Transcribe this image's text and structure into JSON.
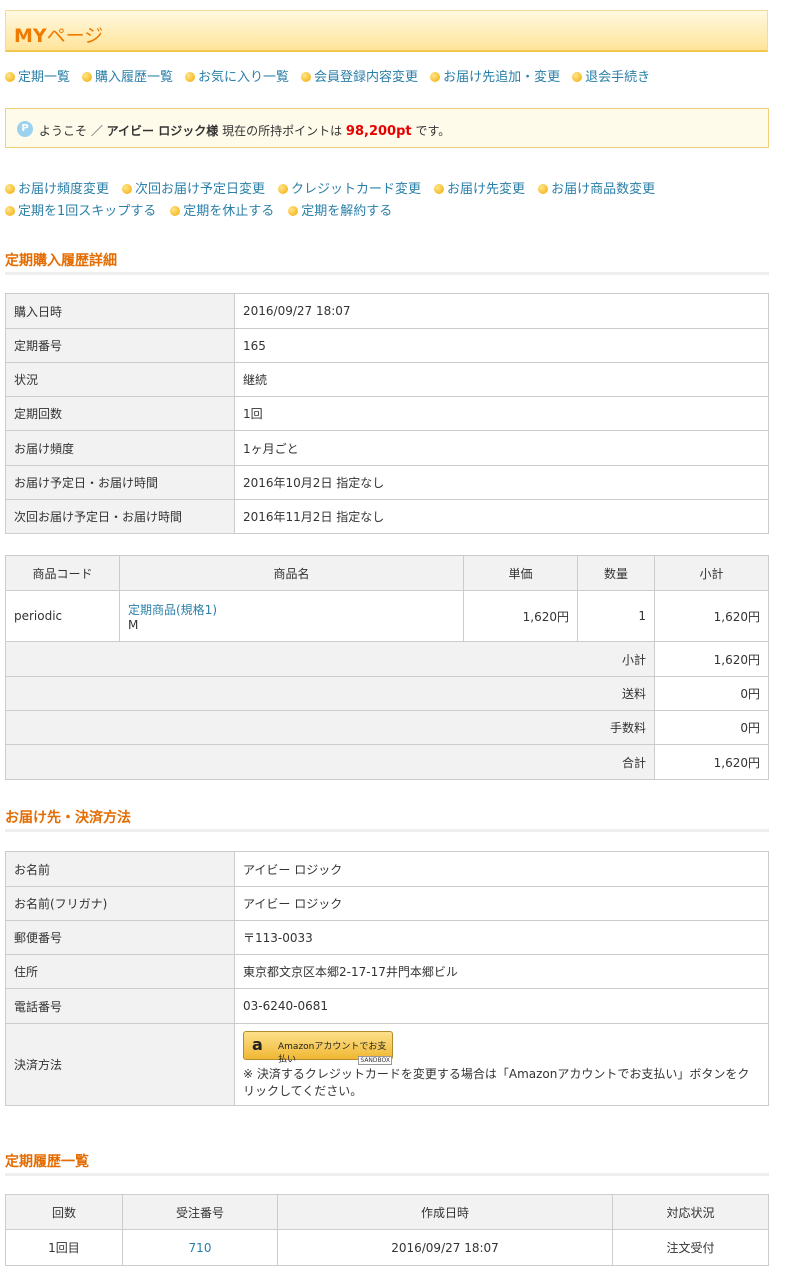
{
  "header": {
    "title_bold": "MY",
    "title_rest": "ページ"
  },
  "nav": [
    "定期一覧",
    "購入履歴一覧",
    "お気に入り一覧",
    "会員登録内容変更",
    "お届け先追加・変更",
    "退会手続き"
  ],
  "welcome": {
    "icon": "P",
    "prefix": "ようこそ ／",
    "user": "アイビー ロジック様",
    "points_label": "現在の所持ポイントは",
    "points": "98,200pt",
    "suffix": "です。"
  },
  "actions_row1": [
    "お届け頻度変更",
    "次回お届け予定日変更",
    "クレジットカード変更",
    "お届け先変更",
    "お届け商品数変更"
  ],
  "actions_row2": [
    "定期を1回スキップする",
    "定期を休止する",
    "定期を解約する"
  ],
  "detail": {
    "title": "定期購入履歴詳細",
    "rows": [
      {
        "label": "購入日時",
        "value": "2016/09/27 18:07"
      },
      {
        "label": "定期番号",
        "value": "165"
      },
      {
        "label": "状況",
        "value": "継続"
      },
      {
        "label": "定期回数",
        "value": "1回"
      },
      {
        "label": "お届け頻度",
        "value": "1ヶ月ごと"
      },
      {
        "label": "お届け予定日・お届け時間",
        "value": "2016年10月2日 指定なし"
      },
      {
        "label": "次回お届け予定日・お届け時間",
        "value": "2016年11月2日 指定なし"
      }
    ]
  },
  "items": {
    "headers": [
      "商品コード",
      "商品名",
      "単価",
      "数量",
      "小計"
    ],
    "rows": [
      {
        "code": "periodic",
        "name": "定期商品(規格1)",
        "variant": "M",
        "price": "1,620円",
        "qty": "1",
        "subtotal": "1,620円"
      }
    ],
    "summary": [
      {
        "label": "小計",
        "value": "1,620円"
      },
      {
        "label": "送料",
        "value": "0円"
      },
      {
        "label": "手数料",
        "value": "0円"
      },
      {
        "label": "合計",
        "value": "1,620円"
      }
    ]
  },
  "delivery": {
    "title": "お届け先・決済方法",
    "rows": [
      {
        "label": "お名前",
        "value": "アイビー ロジック"
      },
      {
        "label": "お名前(フリガナ)",
        "value": "アイビー ロジック"
      },
      {
        "label": "郵便番号",
        "value": "〒113-0033"
      },
      {
        "label": "住所",
        "value": "東京都文京区本郷2-17-17井門本郷ビル"
      },
      {
        "label": "電話番号",
        "value": "03-6240-0681"
      }
    ],
    "payment_label": "決済方法",
    "amazon_button": "Amazonアカウントでお支払い",
    "amazon_sandbox": "SANDBOX",
    "payment_note": "※ 決済するクレジットカードを変更する場合は「Amazonアカウントでお支払い」ボタンをクリックしてください。"
  },
  "history": {
    "title": "定期履歴一覧",
    "headers": [
      "回数",
      "受注番号",
      "作成日時",
      "対応状況"
    ],
    "rows": [
      {
        "count": "1回目",
        "order": "710",
        "created": "2016/09/27 18:07",
        "status": "注文受付"
      }
    ]
  }
}
